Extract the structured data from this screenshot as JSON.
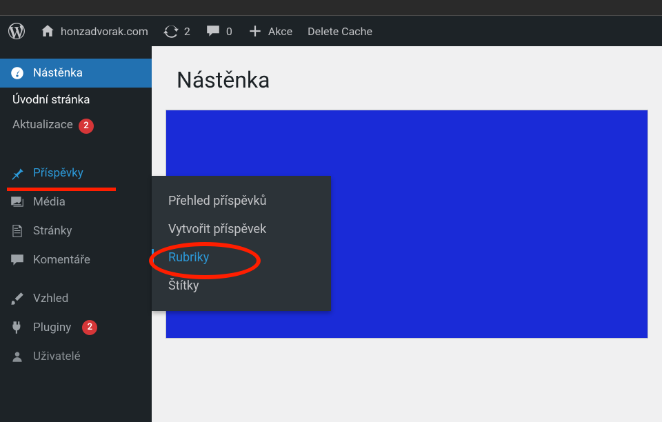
{
  "adminbar": {
    "site_name": "honzadvorak.com",
    "updates_count": "2",
    "comments_count": "0",
    "new_label": "Akce",
    "delete_cache": "Delete Cache"
  },
  "sidebar": {
    "dashboard": "Nástěnka",
    "home": "Úvodní stránka",
    "updates": "Aktualizace",
    "updates_badge": "2",
    "posts": "Příspěvky",
    "media": "Média",
    "pages": "Stránky",
    "comments": "Komentáře",
    "appearance": "Vzhled",
    "plugins": "Pluginy",
    "plugins_badge": "2",
    "users": "Uživatelé"
  },
  "flyout": {
    "all_posts": "Přehled příspěvků",
    "new_post": "Vytvořit příspěvek",
    "categories": "Rubriky",
    "tags": "Štítky"
  },
  "page": {
    "title": "Nástěnka"
  }
}
